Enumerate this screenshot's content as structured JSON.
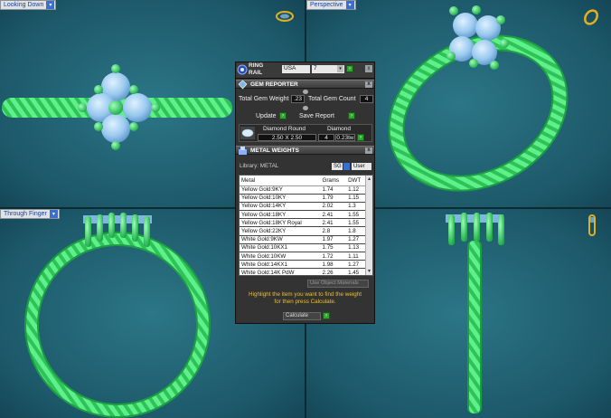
{
  "viewports": [
    {
      "label": "Looking Down",
      "icon": "ring-view-icon"
    },
    {
      "label": "Perspective",
      "icon": "ring-view-icon"
    },
    {
      "label": "Through Finger",
      "icon": "ring-view-icon"
    },
    {
      "label": "",
      "icon": "ring-side-view-icon"
    }
  ],
  "ring_rail": {
    "title_line1": "RING",
    "title_line2": "RAIL",
    "country": "USA",
    "size": "7"
  },
  "gem_reporter": {
    "title": "GEM REPORTER",
    "total_weight_label": "Total Gem Weight",
    "total_weight_value": ".23",
    "total_count_label": "Total Gem Count",
    "total_count_value": "4",
    "update_label": "Update",
    "save_label": "Save Report",
    "gem_name": "Diamond Round",
    "gem_size": "2.50 X 2.50",
    "gem_material": "Diamond",
    "gem_count": "4",
    "gem_weight": "0.23tw"
  },
  "metal_weights": {
    "title": "METAL WEIGHTS",
    "library_label": "Library: METAL",
    "sg_label": "SG",
    "user_label": "User",
    "columns": [
      "Metal",
      "Grams",
      "DWT"
    ],
    "rows": [
      [
        "Yellow Gold:9KY",
        "1.74",
        "1.12"
      ],
      [
        "Yellow Gold:10KY",
        "1.79",
        "1.15"
      ],
      [
        "Yellow Gold:14KY",
        "2.02",
        "1.3"
      ],
      [
        "Yellow Gold:18KY",
        "2.41",
        "1.55"
      ],
      [
        "Yellow Gold:18KY Royal",
        "2.41",
        "1.55"
      ],
      [
        "Yellow Gold:22KY",
        "2.8",
        "1.8"
      ],
      [
        "White Gold:9KW",
        "1.97",
        "1.27"
      ],
      [
        "White Gold:10KX1",
        "1.75",
        "1.13"
      ],
      [
        "White Gold:10KW",
        "1.72",
        "1.11"
      ],
      [
        "White Gold:14KX1",
        "1.98",
        "1.27"
      ],
      [
        "White Gold:14K PdW",
        "2.26",
        "1.45"
      ]
    ],
    "use_object_materials": "Use Object Materials",
    "hint_line1": "Highlight the item you want to find the weight",
    "hint_line2": "for then press Calculate.",
    "calculate_label": "Calculate"
  },
  "colors": {
    "ring_green": "#3ddc6a",
    "gem_blue": "#a9d4f5",
    "viewport_bg": "#226677",
    "panel_bg": "#333333"
  }
}
